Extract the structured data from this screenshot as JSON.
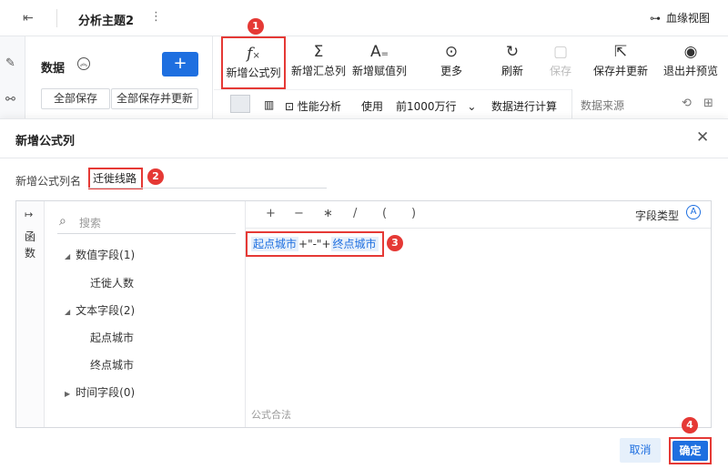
{
  "topbar": {
    "exit_icon": "exit-icon",
    "title": "分析主题2",
    "more_icon": "⋮",
    "lineage": "血缘视图"
  },
  "datapanel": {
    "label": "数据",
    "save_all": "全部保存",
    "save_all_update": "全部保存并更新"
  },
  "toolbar": [
    {
      "name": "new-formula-column",
      "label": "新增公式列",
      "icon": "fx"
    },
    {
      "name": "new-summary-column",
      "label": "新增汇总列",
      "icon": "Σ"
    },
    {
      "name": "new-assign-column",
      "label": "新增赋值列",
      "icon": "A="
    },
    {
      "name": "more",
      "label": "更多",
      "icon": "⋯"
    },
    {
      "name": "refresh",
      "label": "刷新",
      "icon": "↻"
    },
    {
      "name": "save",
      "label": "保存",
      "icon": "save"
    },
    {
      "name": "save-update",
      "label": "保存并更新",
      "icon": "save-update"
    },
    {
      "name": "exit-preview",
      "label": "退出并预览",
      "icon": "eye"
    }
  ],
  "subbar": {
    "perf": "性能分析",
    "use": "使用",
    "rows": "前1000万行",
    "calc": "数据进行计算",
    "datasource": "数据来源"
  },
  "dialog": {
    "title": "新增公式列",
    "name_label": "新增公式列名",
    "name_value": "迁徙线路",
    "rail_text": "函数",
    "search_placeholder": "搜索",
    "tree": {
      "numeric": "数值字段(1)",
      "numeric_item": "迁徙人数",
      "text": "文本字段(2)",
      "text_item1": "起点城市",
      "text_item2": "终点城市",
      "time": "时间字段(0)"
    },
    "ops": [
      "+",
      "−",
      "∗",
      "/",
      "(",
      ")"
    ],
    "field_type": "字段类型",
    "formula": {
      "part1": "起点城市",
      "mid": "+\"-\"+",
      "part2": "终点城市"
    },
    "valid": "公式合法",
    "cancel": "取消",
    "ok": "确定"
  },
  "callouts": [
    "1",
    "2",
    "3",
    "4"
  ]
}
